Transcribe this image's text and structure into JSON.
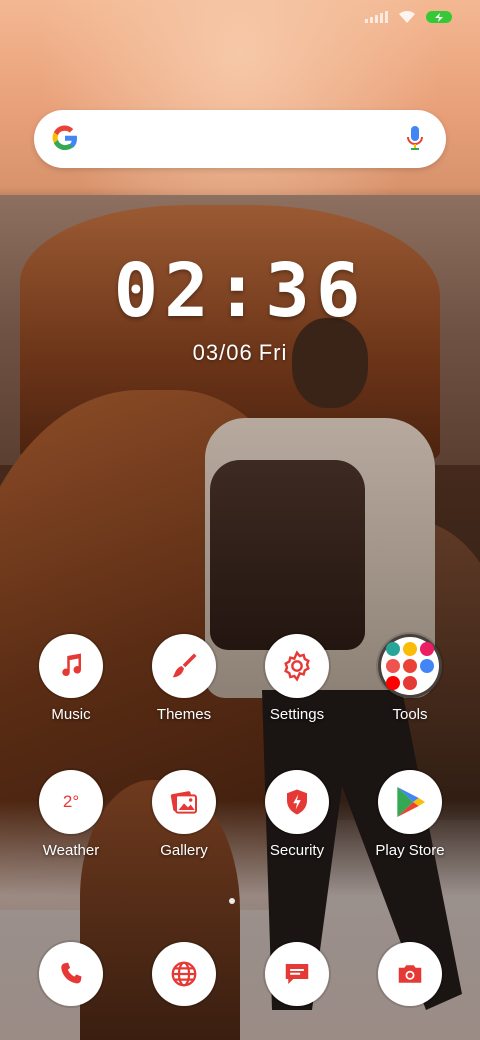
{
  "status_bar": {
    "signal_icon": "signal-bars-icon",
    "wifi_icon": "wifi-icon",
    "battery_icon": "battery-charging-icon",
    "battery_color": "#37c837"
  },
  "search_bar": {
    "logo_icon": "google-g-icon",
    "mic_icon": "microphone-icon"
  },
  "clock": {
    "time": "02:36",
    "date": "03/06",
    "day": "Fri"
  },
  "accent_color": "#e53935",
  "apps_row1": [
    {
      "label": "Music",
      "icon": "music-note-icon"
    },
    {
      "label": "Themes",
      "icon": "paintbrush-icon"
    },
    {
      "label": "Settings",
      "icon": "gear-icon"
    },
    {
      "label": "Tools",
      "icon": "folder-grid-icon"
    }
  ],
  "apps_row2": [
    {
      "label": "Weather",
      "icon": "weather-icon",
      "value": "2°"
    },
    {
      "label": "Gallery",
      "icon": "gallery-icon"
    },
    {
      "label": "Security",
      "icon": "shield-icon"
    },
    {
      "label": "Play Store",
      "icon": "play-store-icon"
    }
  ],
  "dock": [
    {
      "icon": "phone-icon"
    },
    {
      "icon": "globe-icon"
    },
    {
      "icon": "message-icon"
    },
    {
      "icon": "camera-icon"
    }
  ]
}
